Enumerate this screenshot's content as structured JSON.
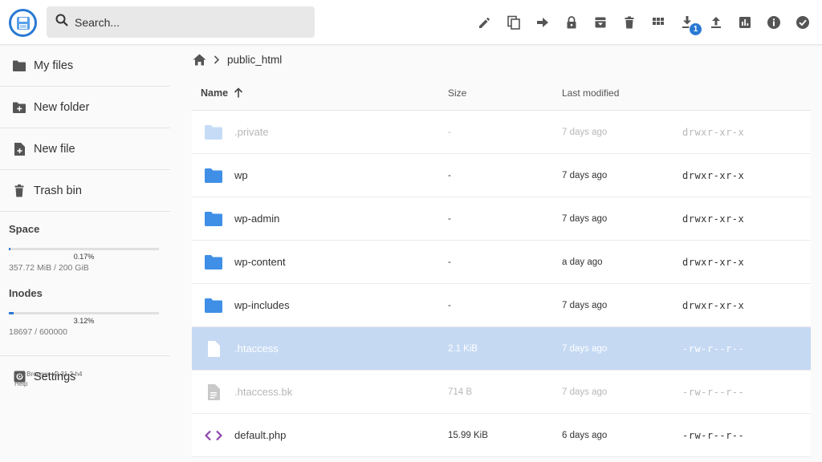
{
  "search": {
    "placeholder": "Search..."
  },
  "toolbar": {
    "icons": [
      "edit-icon",
      "copy-icon",
      "move-icon",
      "lock-icon",
      "archive-icon",
      "delete-icon",
      "grid-view-icon",
      "download-icon",
      "upload-icon",
      "stats-icon",
      "info-icon",
      "select-all-icon"
    ],
    "download_badge": "1"
  },
  "sidebar": {
    "items": [
      {
        "label": "My files",
        "icon": "folder-icon"
      },
      {
        "label": "New folder",
        "icon": "new-folder-icon"
      },
      {
        "label": "New file",
        "icon": "new-file-icon"
      },
      {
        "label": "Trash bin",
        "icon": "trash-icon"
      }
    ],
    "space": {
      "title": "Space",
      "percent": "0.17%",
      "fill": 0.0017,
      "text": "357.72 MiB / 200 GiB"
    },
    "inodes": {
      "title": "Inodes",
      "percent": "3.12%",
      "fill": 0.0312,
      "text": "18697 / 600000"
    },
    "settings": {
      "label": "Settings",
      "icon": "settings-icon"
    },
    "footer": {
      "version": "File Browser v2.31.2-h4",
      "help": "Help"
    }
  },
  "breadcrumb": {
    "path": "public_html"
  },
  "listing": {
    "columns": {
      "name": "Name",
      "size": "Size",
      "modified": "Last modified"
    },
    "rows": [
      {
        "name": ".private",
        "size": "-",
        "modified": "7 days ago",
        "perm": "drwxr-xr-x",
        "type": "folder",
        "state": "dim"
      },
      {
        "name": "wp",
        "size": "-",
        "modified": "7 days ago",
        "perm": "drwxr-xr-x",
        "type": "folder",
        "state": ""
      },
      {
        "name": "wp-admin",
        "size": "-",
        "modified": "7 days ago",
        "perm": "drwxr-xr-x",
        "type": "folder",
        "state": ""
      },
      {
        "name": "wp-content",
        "size": "-",
        "modified": "a day ago",
        "perm": "drwxr-xr-x",
        "type": "folder",
        "state": ""
      },
      {
        "name": "wp-includes",
        "size": "-",
        "modified": "7 days ago",
        "perm": "drwxr-xr-x",
        "type": "folder",
        "state": ""
      },
      {
        "name": ".htaccess",
        "size": "2.1 KiB",
        "modified": "7 days ago",
        "perm": "-rw-r--r--",
        "type": "file",
        "state": "selected"
      },
      {
        "name": ".htaccess.bk",
        "size": "714 B",
        "modified": "7 days ago",
        "perm": "-rw-r--r--",
        "type": "file",
        "state": "dim"
      },
      {
        "name": "default.php",
        "size": "15.99 KiB",
        "modified": "6 days ago",
        "perm": "-rw-r--r--",
        "type": "code",
        "state": ""
      }
    ]
  },
  "colors": {
    "accent": "#2979d4",
    "folder": "#3f8fe6",
    "selected_row": "#c5d9f3",
    "code_icon": "#8e44ad"
  }
}
